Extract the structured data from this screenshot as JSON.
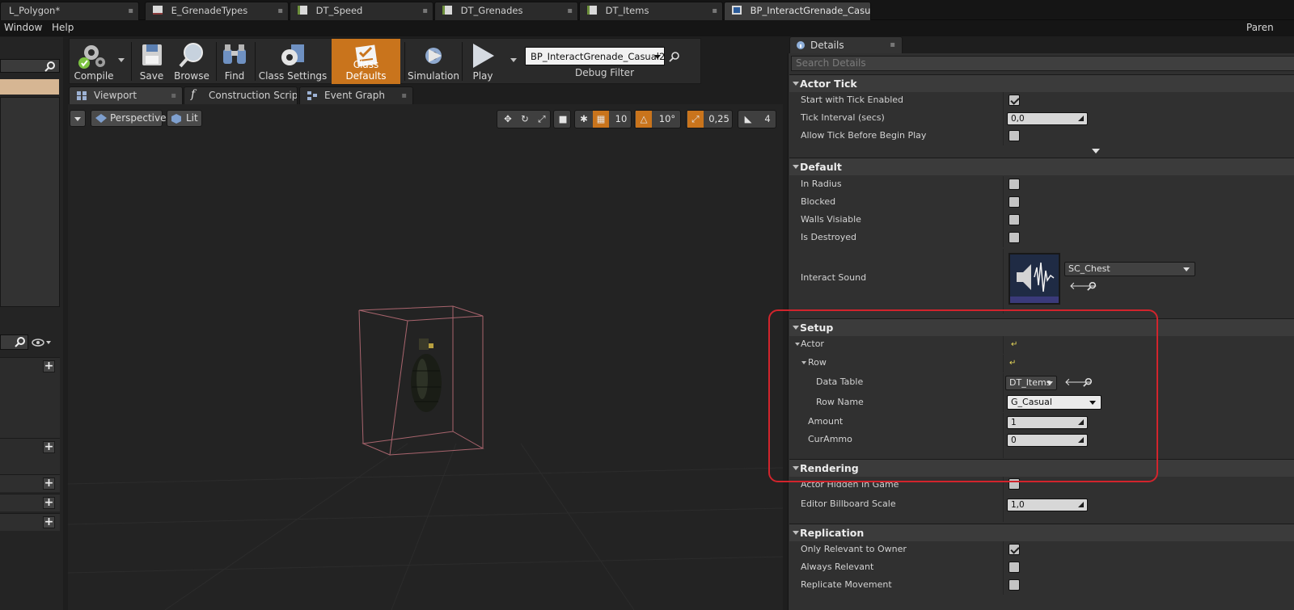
{
  "tabs": [
    {
      "label": "L_Polygon*"
    },
    {
      "label": "E_GrenadeTypes"
    },
    {
      "label": "DT_Speed"
    },
    {
      "label": "DT_Grenades"
    },
    {
      "label": "DT_Items"
    },
    {
      "label": "BP_InteractGrenade_Casu"
    }
  ],
  "menu": {
    "window": "Window",
    "help": "Help",
    "right": "Paren"
  },
  "toolbar": {
    "compile": "Compile",
    "save": "Save",
    "browse": "Browse",
    "find": "Find",
    "class_settings": "Class Settings",
    "class_defaults": "Class Defaults",
    "simulation": "Simulation",
    "play": "Play",
    "debug_object": "BP_InteractGrenade_Casual2",
    "debug_filter": "Debug Filter"
  },
  "view_tabs": [
    {
      "label": "Viewport"
    },
    {
      "label": "Construction Scrip"
    },
    {
      "label": "Event Graph"
    }
  ],
  "viewport": {
    "perspective": "Perspective",
    "lit": "Lit",
    "grid_snap": "10",
    "rot_snap": "10°",
    "scale_snap": "0,25",
    "cam_speed": "4"
  },
  "details": {
    "tab_title": "Details",
    "search_placeholder": "Search Details",
    "categories": {
      "actor_tick": "Actor Tick",
      "default": "Default",
      "setup": "Setup",
      "rendering": "Rendering",
      "replication": "Replication"
    },
    "actor_tick": {
      "start_with_tick": {
        "label": "Start with Tick Enabled",
        "checked": true
      },
      "tick_interval": {
        "label": "Tick Interval (secs)",
        "value": "0,0"
      },
      "allow_tick_before": {
        "label": "Allow Tick Before Begin Play",
        "checked": false
      }
    },
    "default": {
      "in_radius": {
        "label": "In Radius",
        "checked": false
      },
      "blocked": {
        "label": "Blocked",
        "checked": false
      },
      "walls_visiable": {
        "label": "Walls Visiable",
        "checked": false
      },
      "is_destroyed": {
        "label": "Is Destroyed",
        "checked": false
      },
      "interact_sound": {
        "label": "Interact Sound",
        "value": "SC_Chest"
      }
    },
    "setup": {
      "actor": {
        "label": "Actor"
      },
      "row": {
        "label": "Row"
      },
      "data_table": {
        "label": "Data Table",
        "value": "DT_Items"
      },
      "row_name": {
        "label": "Row Name",
        "value": "G_Casual"
      },
      "amount": {
        "label": "Amount",
        "value": "1"
      },
      "cur_ammo": {
        "label": "CurAmmo",
        "value": "0"
      }
    },
    "rendering": {
      "actor_hidden": {
        "label": "Actor Hidden In Game",
        "checked": false
      },
      "billboard_scale": {
        "label": "Editor Billboard Scale",
        "value": "1,0"
      }
    },
    "replication": {
      "only_relevant": {
        "label": "Only Relevant to Owner",
        "checked": true
      },
      "always_relevant": {
        "label": "Always Relevant",
        "checked": false
      },
      "replicate_movement": {
        "label": "Replicate Movement",
        "checked": false
      }
    }
  },
  "colors": {
    "accent": "#c9741c",
    "highlight_box": "#d2242c",
    "viewport_bg": "#232323"
  }
}
